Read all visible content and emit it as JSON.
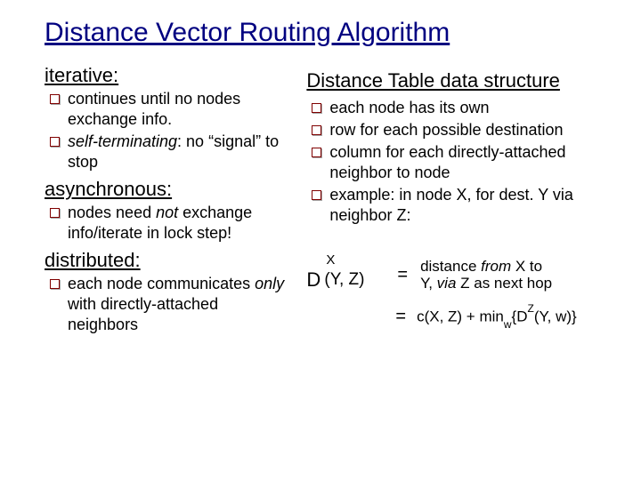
{
  "title": "Distance Vector Routing Algorithm",
  "left": {
    "h1": "iterative:",
    "b1a": "continues until no nodes exchange info.",
    "b1b_pre": "self-terminating",
    "b1b_post": ": no “signal” to stop",
    "h2": "asynchronous:",
    "b2a_pre": "nodes need ",
    "b2a_em": "not",
    "b2a_post": " exchange info/iterate in lock step!",
    "h3": "distributed:",
    "b3a_pre": "each node communicates ",
    "b3a_em": "only",
    "b3a_post": " with directly-attached neighbors"
  },
  "right": {
    "h": "Distance Table data structure",
    "b1": "each node has its own",
    "b2": "row for each possible destination",
    "b3": "column for each directly-attached neighbor to node",
    "b4": "example: in node X, for dest. Y via neighbor Z:"
  },
  "eq": {
    "D": "D",
    "supX": "X",
    "args": "(Y, Z)",
    "eq": "=",
    "rhs1_pre": "distance ",
    "rhs1_em1": "from",
    "rhs1_mid": " X to\nY, ",
    "rhs1_em2": "via",
    "rhs1_post": " Z as next hop",
    "rhs2_a": "c(X, Z) + min",
    "rhs2_sub": "w",
    "rhs2_b": "{D",
    "rhs2_sup": "Z",
    "rhs2_c": "(Y, w)}"
  }
}
